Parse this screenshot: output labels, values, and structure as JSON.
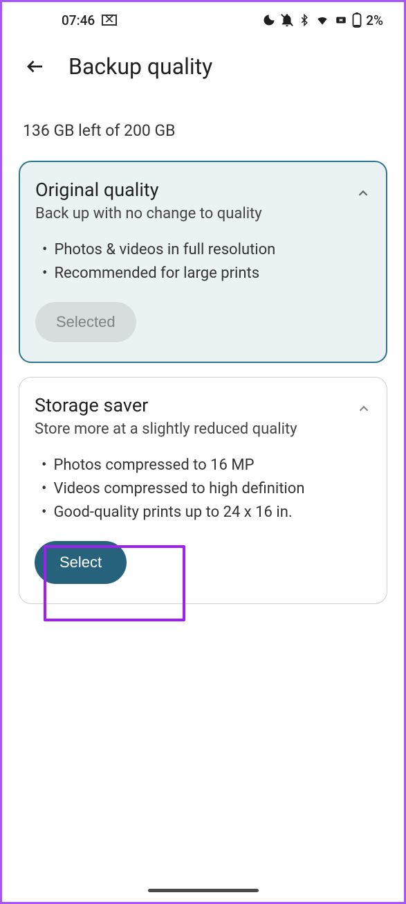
{
  "status": {
    "time": "07:46",
    "battery_pct": "2%"
  },
  "header": {
    "title": "Backup quality"
  },
  "storage": {
    "summary": "136 GB left of 200 GB"
  },
  "cards": {
    "original": {
      "title": "Original quality",
      "subtitle": "Back up with no change to quality",
      "bullets": [
        "Photos & videos in full resolution",
        "Recommended for large prints"
      ],
      "button": "Selected"
    },
    "storage_saver": {
      "title": "Storage saver",
      "subtitle": "Store more at a slightly reduced quality",
      "bullets": [
        "Photos compressed to 16 MP",
        "Videos compressed to high definition",
        "Good-quality prints up to 24 x 16 in."
      ],
      "button": "Select"
    }
  }
}
